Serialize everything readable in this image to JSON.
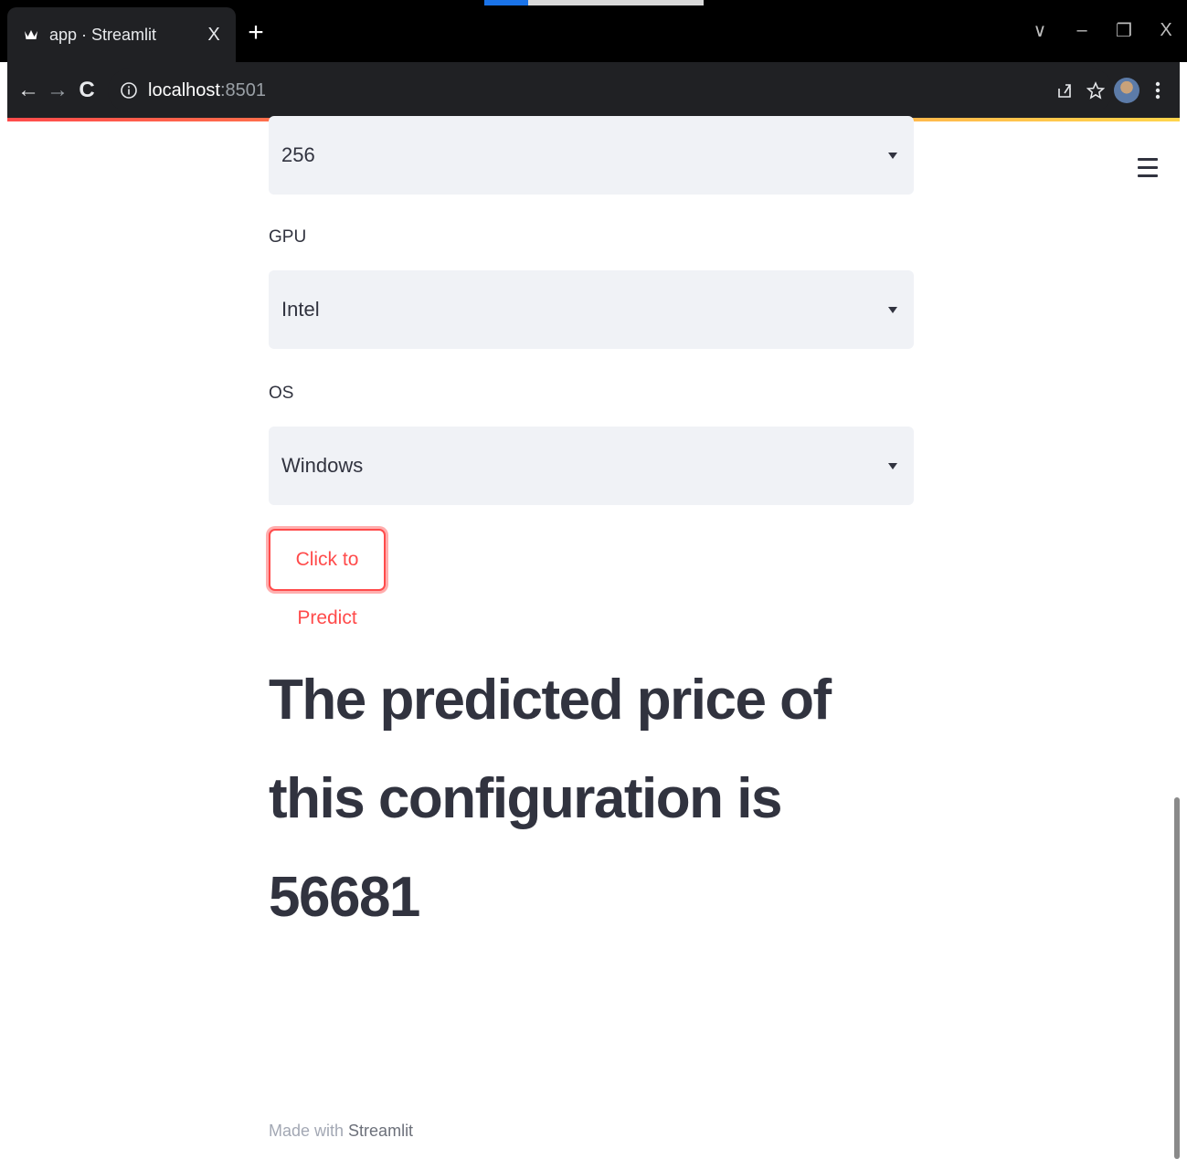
{
  "browser": {
    "tab_title": "app · Streamlit",
    "tab_close": "X",
    "new_tab": "+",
    "url_host": "localhost",
    "url_port": ":8501",
    "window_controls": {
      "dropdown": "∨",
      "minimize": "–",
      "restore": "❐",
      "close": "X"
    },
    "nav": {
      "back": "←",
      "forward": "→",
      "reload": "C"
    }
  },
  "form": {
    "storage_select": {
      "value": "256"
    },
    "gpu": {
      "label": "GPU",
      "value": "Intel"
    },
    "os": {
      "label": "OS",
      "value": "Windows"
    },
    "predict_button": "Click to Predict"
  },
  "result": {
    "text": "The predicted price of this configuration is 56681"
  },
  "footer": {
    "made_with": "Made with ",
    "brand": "Streamlit"
  },
  "colors": {
    "accent": "#ff4b4b",
    "text": "#31333f",
    "select_bg": "#f0f2f6",
    "chrome_bg": "#202124"
  }
}
